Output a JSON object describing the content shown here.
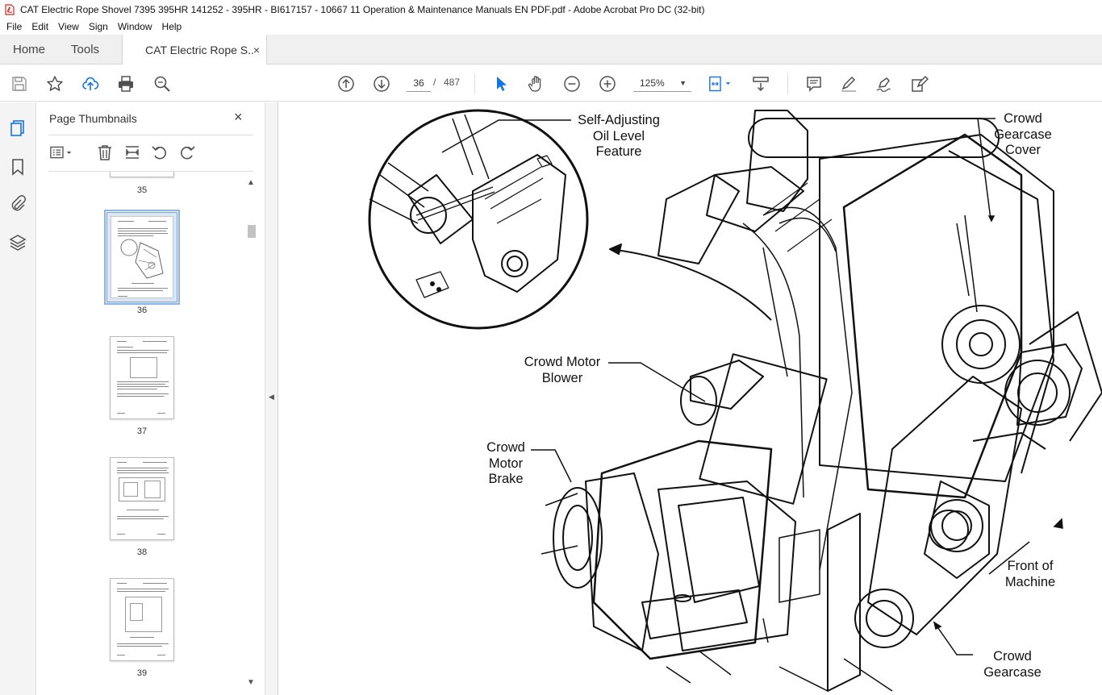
{
  "window": {
    "title": "CAT Electric Rope Shovel 7395 395HR 141252 - 395HR - BI617157 - 10667 11 Operation & Maintenance Manuals EN PDF.pdf - Adobe Acrobat Pro DC (32-bit)"
  },
  "menu": [
    "File",
    "Edit",
    "View",
    "Sign",
    "Window",
    "Help"
  ],
  "tabs": {
    "home": "Home",
    "tools": "Tools",
    "document": "CAT Electric Rope S...",
    "close": "×"
  },
  "toolbar": {
    "current_page": "36",
    "page_separator": "/",
    "total_pages": "487",
    "zoom": "125%"
  },
  "panel": {
    "title": "Page Thumbnails",
    "close": "×",
    "thumbnails": [
      {
        "page": "35",
        "selected": false
      },
      {
        "page": "36",
        "selected": true
      },
      {
        "page": "37",
        "selected": false
      },
      {
        "page": "38",
        "selected": false
      },
      {
        "page": "39",
        "selected": false
      }
    ]
  },
  "document": {
    "callouts": {
      "oil_level_1": "Self-Adjusting",
      "oil_level_2": "Oil Level",
      "oil_level_3": "Feature",
      "gearcase_cover_1": "Crowd",
      "gearcase_cover_2": "Gearcase",
      "gearcase_cover_3": "Cover",
      "blower_1": "Crowd Motor",
      "blower_2": "Blower",
      "brake_1": "Crowd",
      "brake_2": "Motor",
      "brake_3": "Brake",
      "front_1": "Front of",
      "front_2": "Machine",
      "gearcase_1": "Crowd",
      "gearcase_2": "Gearcase"
    }
  },
  "colors": {
    "acrobat_red": "#d7261e",
    "icon_blue": "#1473e6",
    "icon_gray": "#505050",
    "selection": "#8db4e2"
  }
}
